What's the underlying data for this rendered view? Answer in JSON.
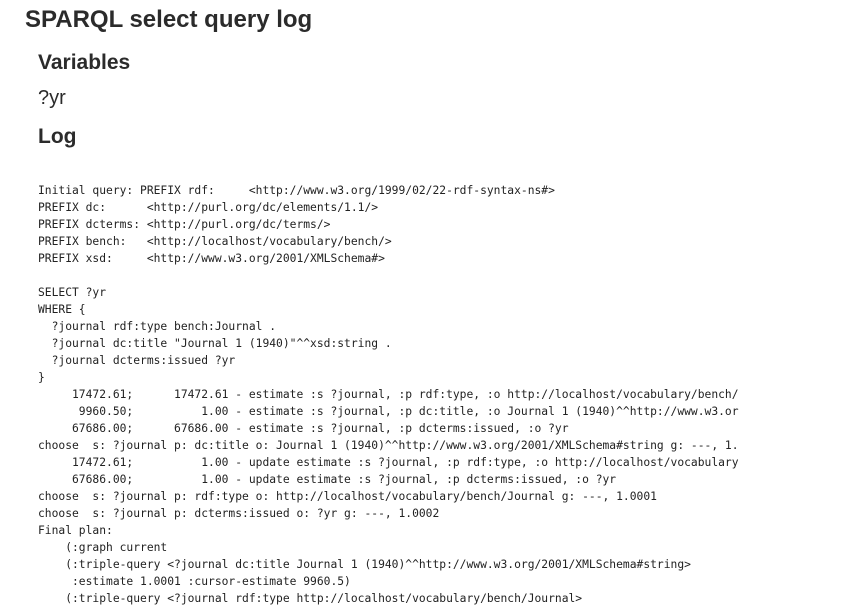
{
  "page": {
    "title": "SPARQL select query log"
  },
  "variables": {
    "heading": "Variables",
    "items": [
      "?yr"
    ]
  },
  "log": {
    "heading": "Log",
    "lines": [
      "Initial query: PREFIX rdf:     <http://www.w3.org/1999/02/22-rdf-syntax-ns#>",
      "PREFIX dc:      <http://purl.org/dc/elements/1.1/>",
      "PREFIX dcterms: <http://purl.org/dc/terms/>",
      "PREFIX bench:   <http://localhost/vocabulary/bench/>",
      "PREFIX xsd:     <http://www.w3.org/2001/XMLSchema#>",
      "",
      "SELECT ?yr",
      "WHERE {",
      "  ?journal rdf:type bench:Journal .",
      "  ?journal dc:title \"Journal 1 (1940)\"^^xsd:string .",
      "  ?journal dcterms:issued ?yr",
      "}",
      "     17472.61;      17472.61 - estimate :s ?journal, :p rdf:type, :o http://localhost/vocabulary/bench/",
      "      9960.50;          1.00 - estimate :s ?journal, :p dc:title, :o Journal 1 (1940)^^http://www.w3.or",
      "     67686.00;      67686.00 - estimate :s ?journal, :p dcterms:issued, :o ?yr",
      "choose  s: ?journal p: dc:title o: Journal 1 (1940)^^http://www.w3.org/2001/XMLSchema#string g: ---, 1.",
      "     17472.61;          1.00 - update estimate :s ?journal, :p rdf:type, :o http://localhost/vocabulary",
      "     67686.00;          1.00 - update estimate :s ?journal, :p dcterms:issued, :o ?yr",
      "choose  s: ?journal p: rdf:type o: http://localhost/vocabulary/bench/Journal g: ---, 1.0001",
      "choose  s: ?journal p: dcterms:issued o: ?yr g: ---, 1.0002",
      "Final plan:",
      "    (:graph current",
      "    (:triple-query <?journal dc:title Journal 1 (1940)^^http://www.w3.org/2001/XMLSchema#string>",
      "     :estimate 1.0001 :cursor-estimate 9960.5)",
      "    (:triple-query <?journal rdf:type http://localhost/vocabulary/bench/Journal>"
    ]
  }
}
